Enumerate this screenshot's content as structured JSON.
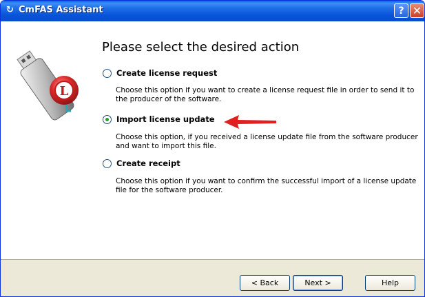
{
  "window": {
    "title": "CmFAS Assistant",
    "app_icon": "cmfas-icon",
    "help_button": "?",
    "close_button": "✕"
  },
  "heading": "Please select the desired action",
  "options": [
    {
      "label": "Create license request",
      "description": "Choose this option if you want to create a license request file in order to send it to the producer of the software.",
      "selected": false
    },
    {
      "label": "Import license update",
      "description": "Choose this option, if you received a license update file from the software producer and want to import this file.",
      "selected": true
    },
    {
      "label": "Create receipt",
      "description": "Choose this option if you want to confirm the successful import of a license update file for the software producer.",
      "selected": false
    }
  ],
  "buttons": {
    "back": "< Back",
    "next": "Next >",
    "help": "Help"
  },
  "colors": {
    "arrow": "#e02020",
    "titlebar": "#0a5fe8",
    "radio_selected": "#21a121"
  }
}
